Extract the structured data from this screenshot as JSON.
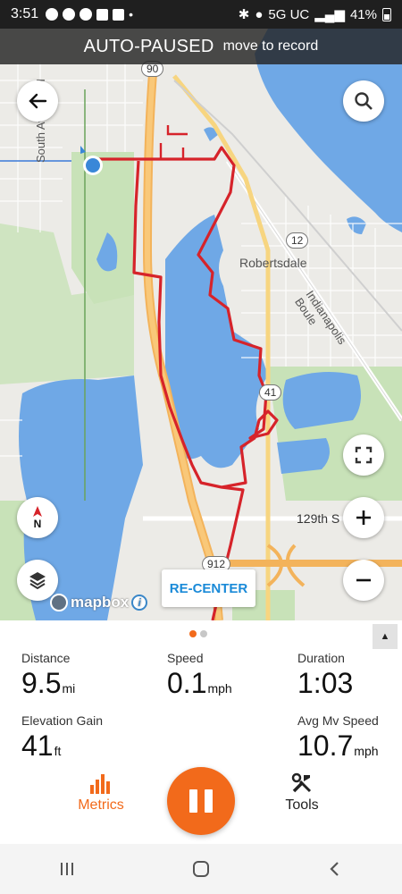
{
  "status_bar": {
    "time": "3:51",
    "network": "5G UC",
    "battery": "41%"
  },
  "banner": {
    "title": "AUTO-PAUSED",
    "subtitle": "move to record"
  },
  "map": {
    "road_labels": {
      "south_avenue": "South Avenue H",
      "robertsdale": "Robertsdale",
      "indianapolis": "Indianapolis Boule",
      "street_129th": "129th S"
    },
    "shields": {
      "i90": "90",
      "r12": "12",
      "r41": "41",
      "r912": "912"
    },
    "compass_label": "N",
    "attribution": "mapbox",
    "recenter_label": "RE-CENTER",
    "route_color": "#d6232a",
    "water_color": "#6fa8e6"
  },
  "metrics": {
    "distance": {
      "label": "Distance",
      "value": "9.5",
      "unit": "mi"
    },
    "speed": {
      "label": "Speed",
      "value": "0.1",
      "unit": "mph"
    },
    "duration": {
      "label": "Duration",
      "value": "1:03"
    },
    "elevation": {
      "label": "Elevation Gain",
      "value": "41",
      "unit": "ft"
    },
    "avg_speed": {
      "label": "Avg Mv Speed",
      "value": "10.7",
      "unit": "mph"
    }
  },
  "bottom_nav": {
    "metrics_label": "Metrics",
    "tools_label": "Tools",
    "accent": "#f26a1b"
  }
}
